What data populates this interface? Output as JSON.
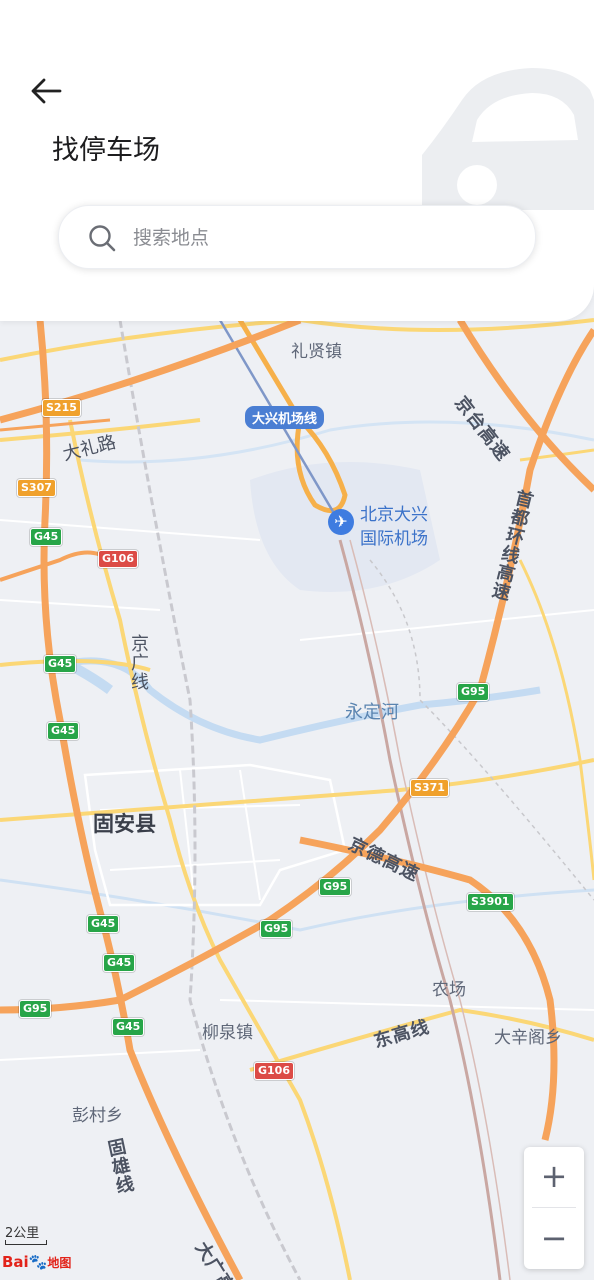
{
  "header": {
    "title": "找停车场",
    "back_icon": "arrow-left-icon",
    "decoration_icon": "car-icon"
  },
  "search": {
    "placeholder": "搜索地点",
    "icon": "search-icon"
  },
  "map": {
    "place_labels": {
      "lixian": "礼贤镇",
      "dalilu": "大礼路",
      "gu_an": "固安县",
      "liuquan": "柳泉镇",
      "pengcun": "彭村乡",
      "nongchang": "农场",
      "daxinzhuang": "大辛阁乡",
      "airport_line1": "北京大兴",
      "airport_line2": "国际机场"
    },
    "road_labels": {
      "jingtai": "京台高速",
      "shoudu": "首都环线高速",
      "jingguang": "京广线",
      "jingde": "京德高速",
      "donggao": "东高线",
      "guxiong": "固雄线",
      "daguang": "大广高"
    },
    "water_labels": {
      "yongding": "永定河"
    },
    "metro_label": "大兴机场线",
    "shields": {
      "s215": "S215",
      "s307": "S307",
      "g45_a": "G45",
      "g106_a": "G106",
      "g45_b": "G45",
      "g45_c": "G45",
      "g95_a": "G95",
      "s371": "S371",
      "g95_b": "G95",
      "s3901": "S3901",
      "g95_c": "G95",
      "g45_d": "G45",
      "g45_e": "G45",
      "g95_d": "G95",
      "g45_f": "G45",
      "g106_b": "G106"
    },
    "scale_text": "2公里",
    "logo_text": "Bai",
    "logo_text2": "du",
    "logo_text3": "地图"
  },
  "zoom": {
    "in_label": "+",
    "out_label": "−"
  },
  "colors": {
    "highway": "#f6a35b",
    "road": "#fbd776",
    "water": "#c4dbf2",
    "rail": "#c9a7a2",
    "accent": "#3f7ce0"
  }
}
